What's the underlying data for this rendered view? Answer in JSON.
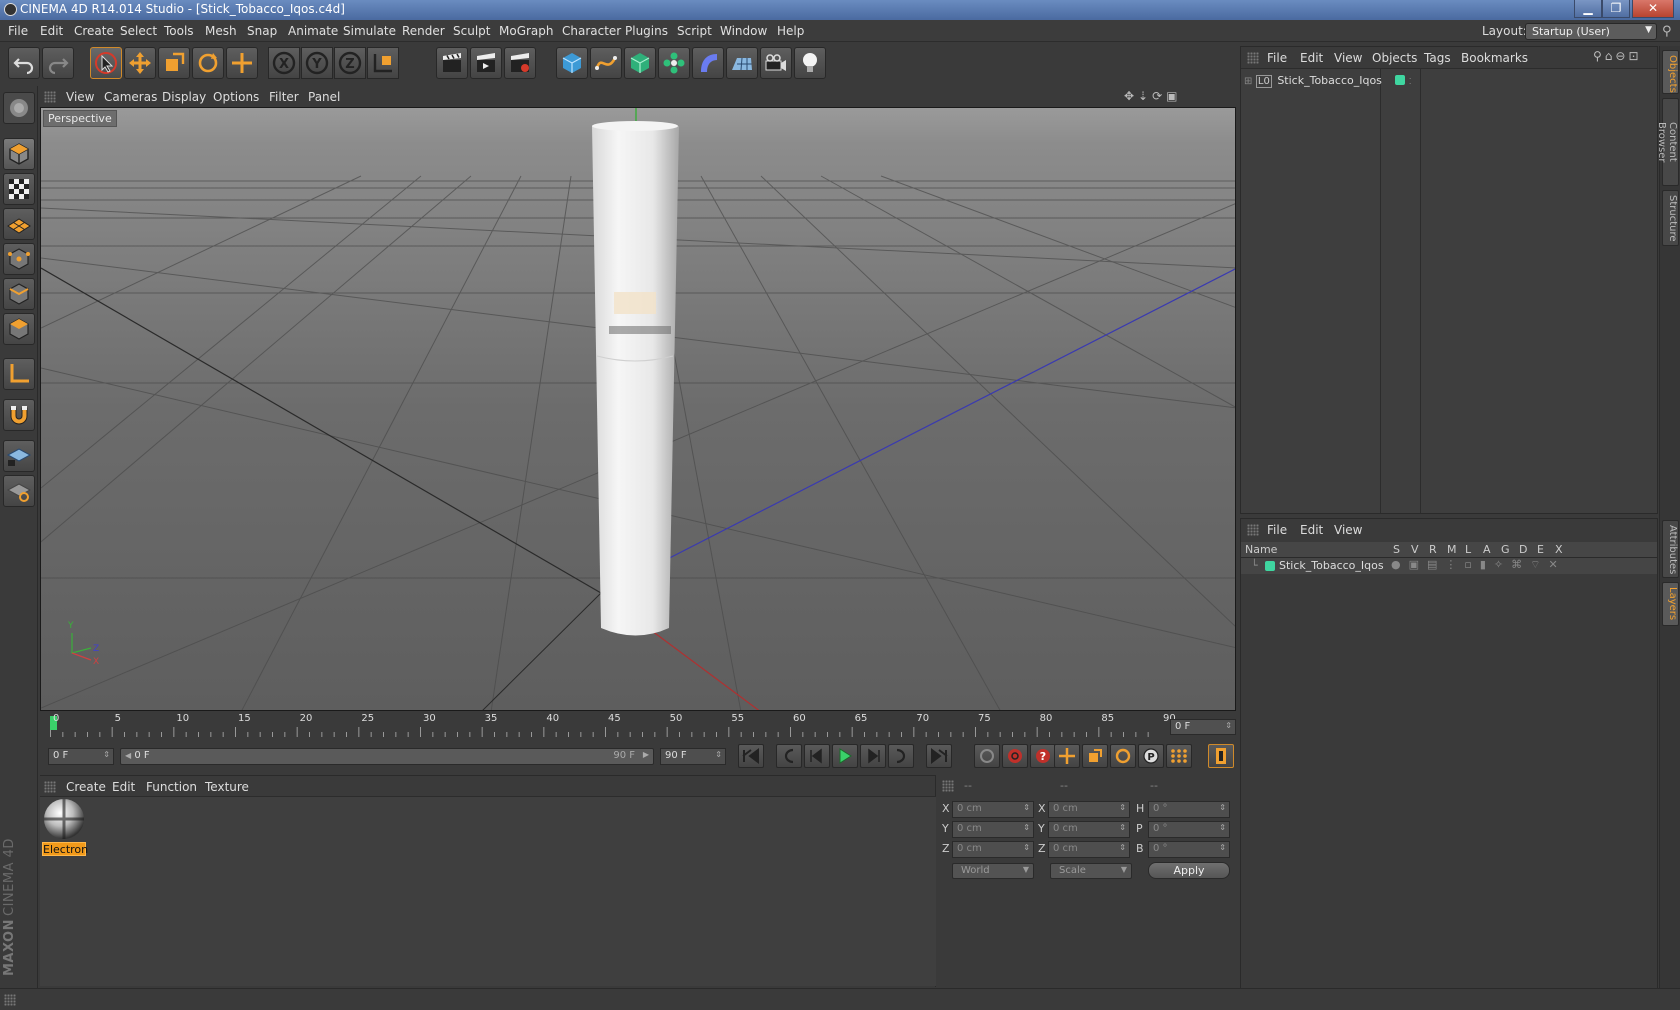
{
  "window": {
    "title": "CINEMA 4D R14.014 Studio - [Stick_Tobacco_Iqos.c4d]",
    "minimize": "▁",
    "maximize": "❐",
    "close": "✕"
  },
  "menubar": {
    "items": [
      "File",
      "Edit",
      "Create",
      "Select",
      "Tools",
      "Mesh",
      "Snap",
      "Animate",
      "Simulate",
      "Render",
      "Sculpt",
      "MoGraph",
      "Character",
      "Plugins",
      "Script",
      "Window",
      "Help"
    ],
    "layout_label": "Layout:",
    "layout_value": "Startup (User)"
  },
  "viewport": {
    "menu": [
      "View",
      "Cameras",
      "Display",
      "Options",
      "Filter",
      "Panel"
    ],
    "label": "Perspective",
    "axes": {
      "y": "Y",
      "z": "Z",
      "x": "X"
    }
  },
  "timeline": {
    "ticks": [
      "0",
      "5",
      "10",
      "15",
      "20",
      "25",
      "30",
      "35",
      "40",
      "45",
      "50",
      "55",
      "60",
      "65",
      "70",
      "75",
      "80",
      "85",
      "90"
    ],
    "current_frame": "0 F"
  },
  "transport": {
    "start_field": "0 F",
    "range_start": "0 F",
    "range_end": "90 F",
    "end_field": "90 F"
  },
  "materials": {
    "menu": [
      "Create",
      "Edit",
      "Function",
      "Texture"
    ],
    "items": [
      {
        "name": "Electron"
      }
    ]
  },
  "coordinates": {
    "headers": [
      "--",
      "--",
      "--"
    ],
    "rows": [
      {
        "a1": "X",
        "v1": "0 cm",
        "a2": "X",
        "v2": "0 cm",
        "a3": "H",
        "v3": "0 °"
      },
      {
        "a1": "Y",
        "v1": "0 cm",
        "a2": "Y",
        "v2": "0 cm",
        "a3": "P",
        "v3": "0 °"
      },
      {
        "a1": "Z",
        "v1": "0 cm",
        "a2": "Z",
        "v2": "0 cm",
        "a3": "B",
        "v3": "0 °"
      }
    ],
    "space_select": "World",
    "mode_select": "Scale",
    "apply": "Apply"
  },
  "object_manager": {
    "menu": [
      "File",
      "Edit",
      "View",
      "Objects",
      "Tags",
      "Bookmarks"
    ],
    "objects": [
      {
        "name": "Stick_Tobacco_Iqos",
        "color": "#3fd6a0"
      }
    ]
  },
  "layer_manager": {
    "menu": [
      "File",
      "Edit",
      "View"
    ],
    "columns": [
      "Name",
      "S",
      "V",
      "R",
      "M",
      "L",
      "A",
      "G",
      "D",
      "E",
      "X"
    ],
    "layers": [
      {
        "name": "Stick_Tobacco_Iqos",
        "color": "#3fd6a0"
      }
    ]
  },
  "right_tabs": [
    "Objects",
    "Content Browser",
    "Structure",
    "Attributes",
    "Layers"
  ],
  "branding": {
    "maxon": "MAXON",
    "cinema": "CINEMA 4D"
  },
  "colors": {
    "accent": "#f29a1a",
    "layer": "#3fd6a0",
    "timeline_marker": "#3ad06a"
  }
}
